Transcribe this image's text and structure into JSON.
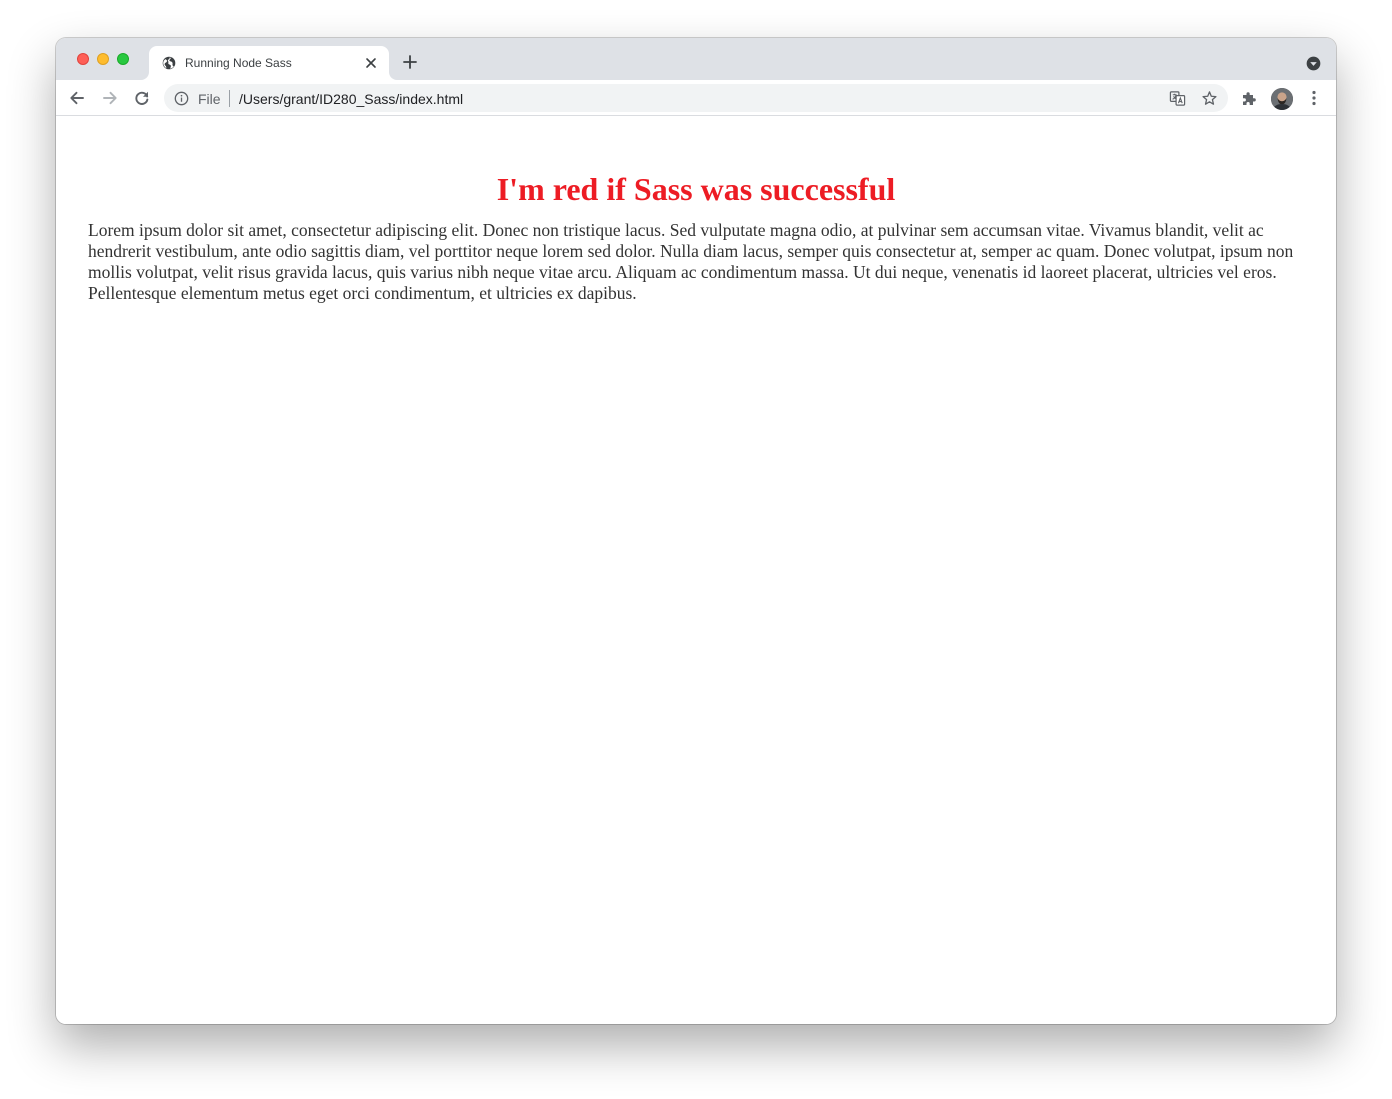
{
  "browser": {
    "tab": {
      "title": "Running Node Sass",
      "favicon_icon": "globe-icon",
      "close_icon": "close-icon"
    },
    "new_tab_icon": "plus-icon",
    "tab_search_icon": "tab-search-dropdown-icon",
    "toolbar": {
      "back_icon": "arrow-left-icon",
      "forward_icon": "arrow-right-icon",
      "reload_icon": "reload-icon",
      "extensions_icon": "puzzle-piece-icon",
      "menu_icon": "kebab-menu-icon"
    },
    "omnibox": {
      "info_icon": "info-icon",
      "scheme_label": "File",
      "url": "/Users/grant/ID280_Sass/index.html",
      "translate_icon": "translate-icon",
      "bookmark_icon": "star-icon"
    },
    "traffic_lights": {
      "close_color": "#fe5f57",
      "minimize_color": "#febc2e",
      "maximize_color": "#28c840"
    }
  },
  "page": {
    "heading": "I'm red if Sass was successful",
    "heading_color": "#ed1c24",
    "body_text": "Lorem ipsum dolor sit amet, consectetur adipiscing elit. Donec non tristique lacus. Sed vulputate magna odio, at pulvinar sem accumsan vitae. Vivamus blandit, velit ac hendrerit vestibulum, ante odio sagittis diam, vel porttitor neque lorem sed dolor. Nulla diam lacus, semper quis consectetur at, semper ac quam. Donec volutpat, ipsum non mollis volutpat, velit risus gravida lacus, quis varius nibh neque vitae arcu. Aliquam ac condimentum massa. Ut dui neque, venenatis id laoreet placerat, ultricies vel eros. Pellentesque elementum metus eget orci condimentum, et ultricies ex dapibus."
  }
}
